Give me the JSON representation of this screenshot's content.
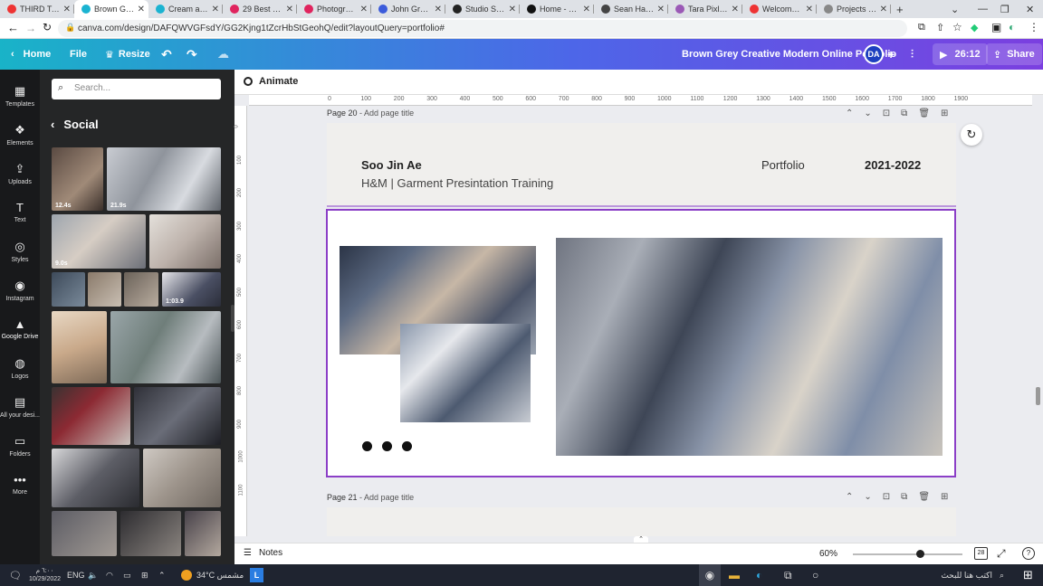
{
  "browser": {
    "tabs": [
      {
        "title": "THIRD TASK",
        "color": "#e33",
        "active": false
      },
      {
        "title": "Brown Grey C",
        "color": "#1bb3d1",
        "active": true
      },
      {
        "title": "Cream and G",
        "color": "#1bb3d1",
        "active": false
      },
      {
        "title": "29 Best Portf",
        "color": "#e0245e",
        "active": false
      },
      {
        "title": "Photography",
        "color": "#e0245e",
        "active": false
      },
      {
        "title": "John Green",
        "color": "#3b5bdb",
        "active": false
      },
      {
        "title": "Studio Schun",
        "color": "#222",
        "active": false
      },
      {
        "title": "Home - Jenn",
        "color": "#111",
        "active": false
      },
      {
        "title": "Sean Halpin",
        "color": "#444",
        "active": false
      },
      {
        "title": "Tara Pixley P",
        "color": "#9b59b6",
        "active": false
      },
      {
        "title": "Welcome | M",
        "color": "#e33",
        "active": false
      },
      {
        "title": "Projects - Di",
        "color": "#888",
        "active": false
      }
    ],
    "new_tab": "+",
    "url": "canva.com/design/DAFQWVGFsdY/GG2Kjng1tZcrHbStGeohQ/edit?layoutQuery=portfolio#"
  },
  "topbar": {
    "home": "Home",
    "file": "File",
    "resize": "Resize",
    "doc_title": "Brown Grey Creative Modern Online Portfolio",
    "avatar": "DA",
    "timer": "26:12",
    "share": "Share"
  },
  "rail": [
    {
      "label": "Templates",
      "icon": "templates-icon",
      "glyph": "▦"
    },
    {
      "label": "Elements",
      "icon": "elements-icon",
      "glyph": "❖"
    },
    {
      "label": "Uploads",
      "icon": "uploads-icon",
      "glyph": "⇪"
    },
    {
      "label": "Text",
      "icon": "text-icon",
      "glyph": "T"
    },
    {
      "label": "Styles",
      "icon": "styles-icon",
      "glyph": "◎"
    },
    {
      "label": "Instagram",
      "icon": "instagram-icon",
      "glyph": "◉"
    },
    {
      "label": "Google Drive",
      "icon": "google-drive-icon",
      "glyph": "▲"
    },
    {
      "label": "Logos",
      "icon": "logos-icon",
      "glyph": "◍"
    },
    {
      "label": "All your desi...",
      "icon": "all-designs-icon",
      "glyph": "▤"
    },
    {
      "label": "Folders",
      "icon": "folders-icon",
      "glyph": "▭"
    },
    {
      "label": "More",
      "icon": "more-icon",
      "glyph": "•••"
    }
  ],
  "panel": {
    "search_placeholder": "Search...",
    "section": "Social",
    "durations": [
      "12.4s",
      "21.9s",
      "9.0s",
      "1:03.9"
    ]
  },
  "editor": {
    "animate": "Animate",
    "ruler_ticks": [
      "0",
      "100",
      "200",
      "300",
      "400",
      "500",
      "600",
      "700",
      "800",
      "900",
      "1000",
      "1100",
      "1200",
      "1300",
      "1400",
      "1500",
      "1600",
      "1700",
      "1800",
      "1900"
    ],
    "ruler_left_ticks": [
      "0",
      "100",
      "200",
      "300",
      "400",
      "500",
      "600",
      "700",
      "800",
      "900",
      "1000",
      "1100"
    ],
    "page20_label": "Page 20",
    "page21_label": "Page 21",
    "add_title": "- Add page title",
    "name": "Soo Jin Ae",
    "role": "H&M | Garment Presintation Training",
    "portfolio": "Portfolio",
    "years": "2021-2022",
    "notes": "Notes",
    "zoom": "60%",
    "zoom_level": 0.6,
    "page_count": "28"
  },
  "taskbar": {
    "time": "٦:٠٠ م",
    "date": "10/29/2022",
    "lang": "ENG",
    "weather": "34°C مشمس",
    "search": "اكتب هنا للبحث"
  }
}
